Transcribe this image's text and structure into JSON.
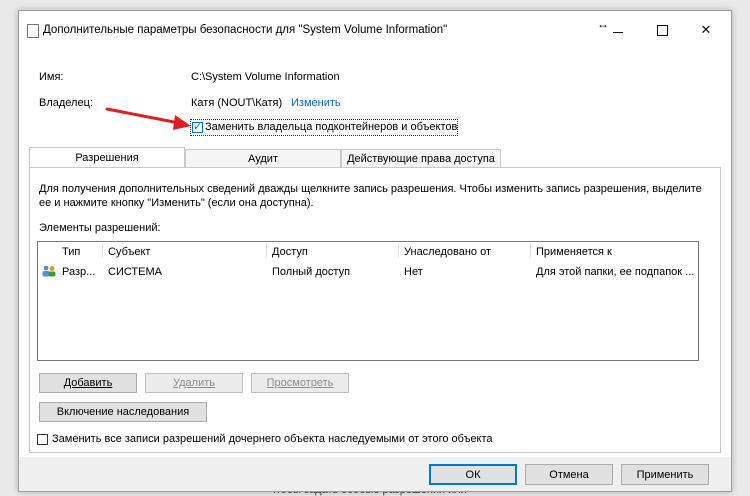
{
  "window": {
    "title": "Дополнительные параметры безопасности  для \"System Volume Information\"",
    "resize_glyph": "↔"
  },
  "info": {
    "name_label": "Имя:",
    "name_value": "C:\\System Volume Information",
    "owner_label": "Владелец:",
    "owner_value": "Катя (NOUT\\Катя)",
    "change_link": "Изменить",
    "replace_owner_label": "Заменить владельца подконтейнеров и объектов",
    "replace_owner_checked": true
  },
  "tabs": [
    {
      "label": "Разрешения",
      "active": true
    },
    {
      "label": "Аудит",
      "active": false
    },
    {
      "label": "Действующие права доступа",
      "active": false
    }
  ],
  "permissions": {
    "description_line1": "Для получения дополнительных сведений дважды щелкните запись разрешения. Чтобы изменить запись разрешения, выделите",
    "description_line2": "ее и нажмите кнопку \"Изменить\" (если она доступна).",
    "list_label": "Элементы разрешений:",
    "columns": [
      "Тип",
      "Субъект",
      "Доступ",
      "Унаследовано от",
      "Применяется к"
    ],
    "rows": [
      {
        "type": "Разр...",
        "subject": "СИСТЕМА",
        "access": "Полный доступ",
        "inherited": "Нет",
        "applies": "Для этой папки, ее подпапок ..."
      }
    ]
  },
  "buttons": {
    "add": "Добавить",
    "remove": "Удалить",
    "view": "Просмотреть",
    "inheritance": "Включение наследования",
    "ok": "ОК",
    "cancel": "Отмена",
    "apply": "Применить"
  },
  "replace_child_label": "Заменить все записи разрешений дочернего объекта наследуемыми от этого объекта",
  "replace_child_checked": false,
  "background_text": "чтобы задать особые разрешения или",
  "colors": {
    "accent": "#0078d7",
    "arrow": "#e02020",
    "link": "#0066cc"
  }
}
